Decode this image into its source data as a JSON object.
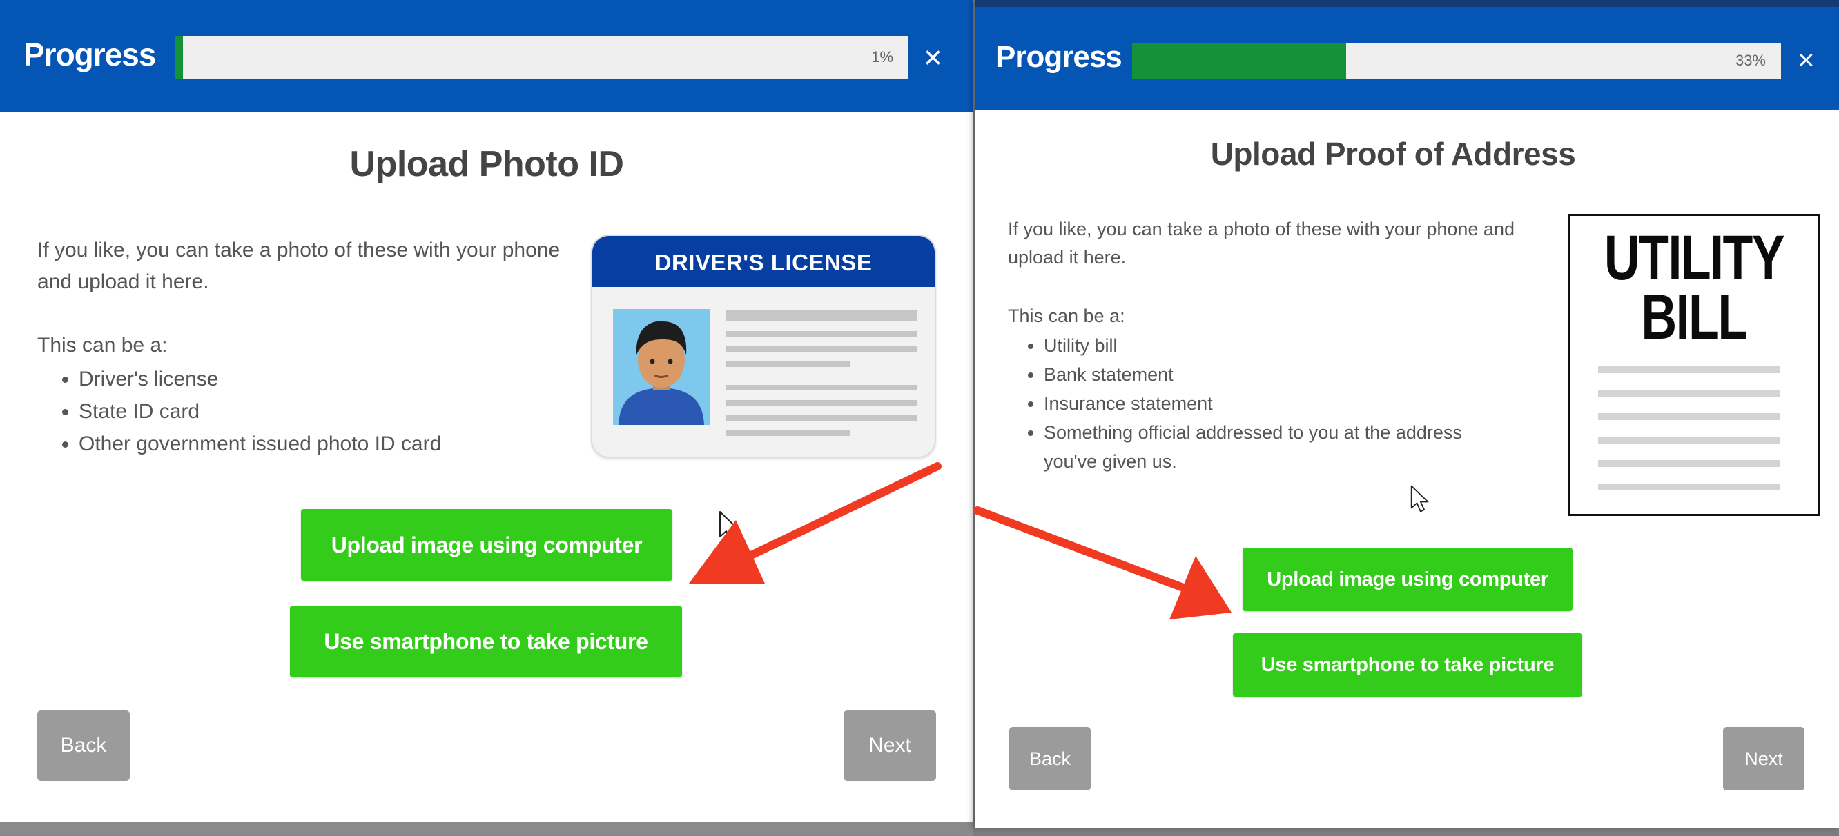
{
  "colors": {
    "header_blue": "#0555b5",
    "progress_green": "#13923a",
    "button_green": "#33cc1a",
    "button_gray": "#9b9b9b",
    "license_blue": "#063ea1",
    "arrow_red": "#f03a22"
  },
  "left_panel": {
    "header": {
      "title": "Progress",
      "progress": {
        "percent": 1,
        "label": "1%"
      },
      "close": "×"
    },
    "heading": "Upload Photo ID",
    "intro": "If you like, you can take a photo of these with your phone and upload it here.",
    "can_be_label": "This can be a:",
    "options": [
      "Driver's license",
      "State ID card",
      "Other government issued photo ID card"
    ],
    "illustration": {
      "title": "DRIVER'S LICENSE",
      "icons": [
        "driver-license-icon",
        "person-portrait-icon"
      ]
    },
    "buttons": {
      "upload": "Upload image using computer",
      "smartphone": "Use smartphone to take picture",
      "back": "Back",
      "next": "Next"
    }
  },
  "right_panel": {
    "header": {
      "title": "Progress",
      "progress": {
        "percent": 33,
        "label": "33%"
      },
      "close": "×"
    },
    "heading": "Upload Proof of Address",
    "intro": "If you like, you can take a photo of these with your phone and upload it here.",
    "can_be_label": "This can be a:",
    "options": [
      "Utility bill",
      "Bank statement",
      "Insurance statement",
      "Something official addressed to you at the address you've given us."
    ],
    "illustration": {
      "title_line1": "UTILITY",
      "title_line2": "BILL",
      "icons": [
        "utility-bill-icon"
      ]
    },
    "buttons": {
      "upload": "Upload image using computer",
      "smartphone": "Use smartphone to take picture",
      "back": "Back",
      "next": "Next"
    }
  },
  "annotations": {
    "icons": [
      "red-arrow-icon",
      "mouse-cursor-icon"
    ]
  }
}
